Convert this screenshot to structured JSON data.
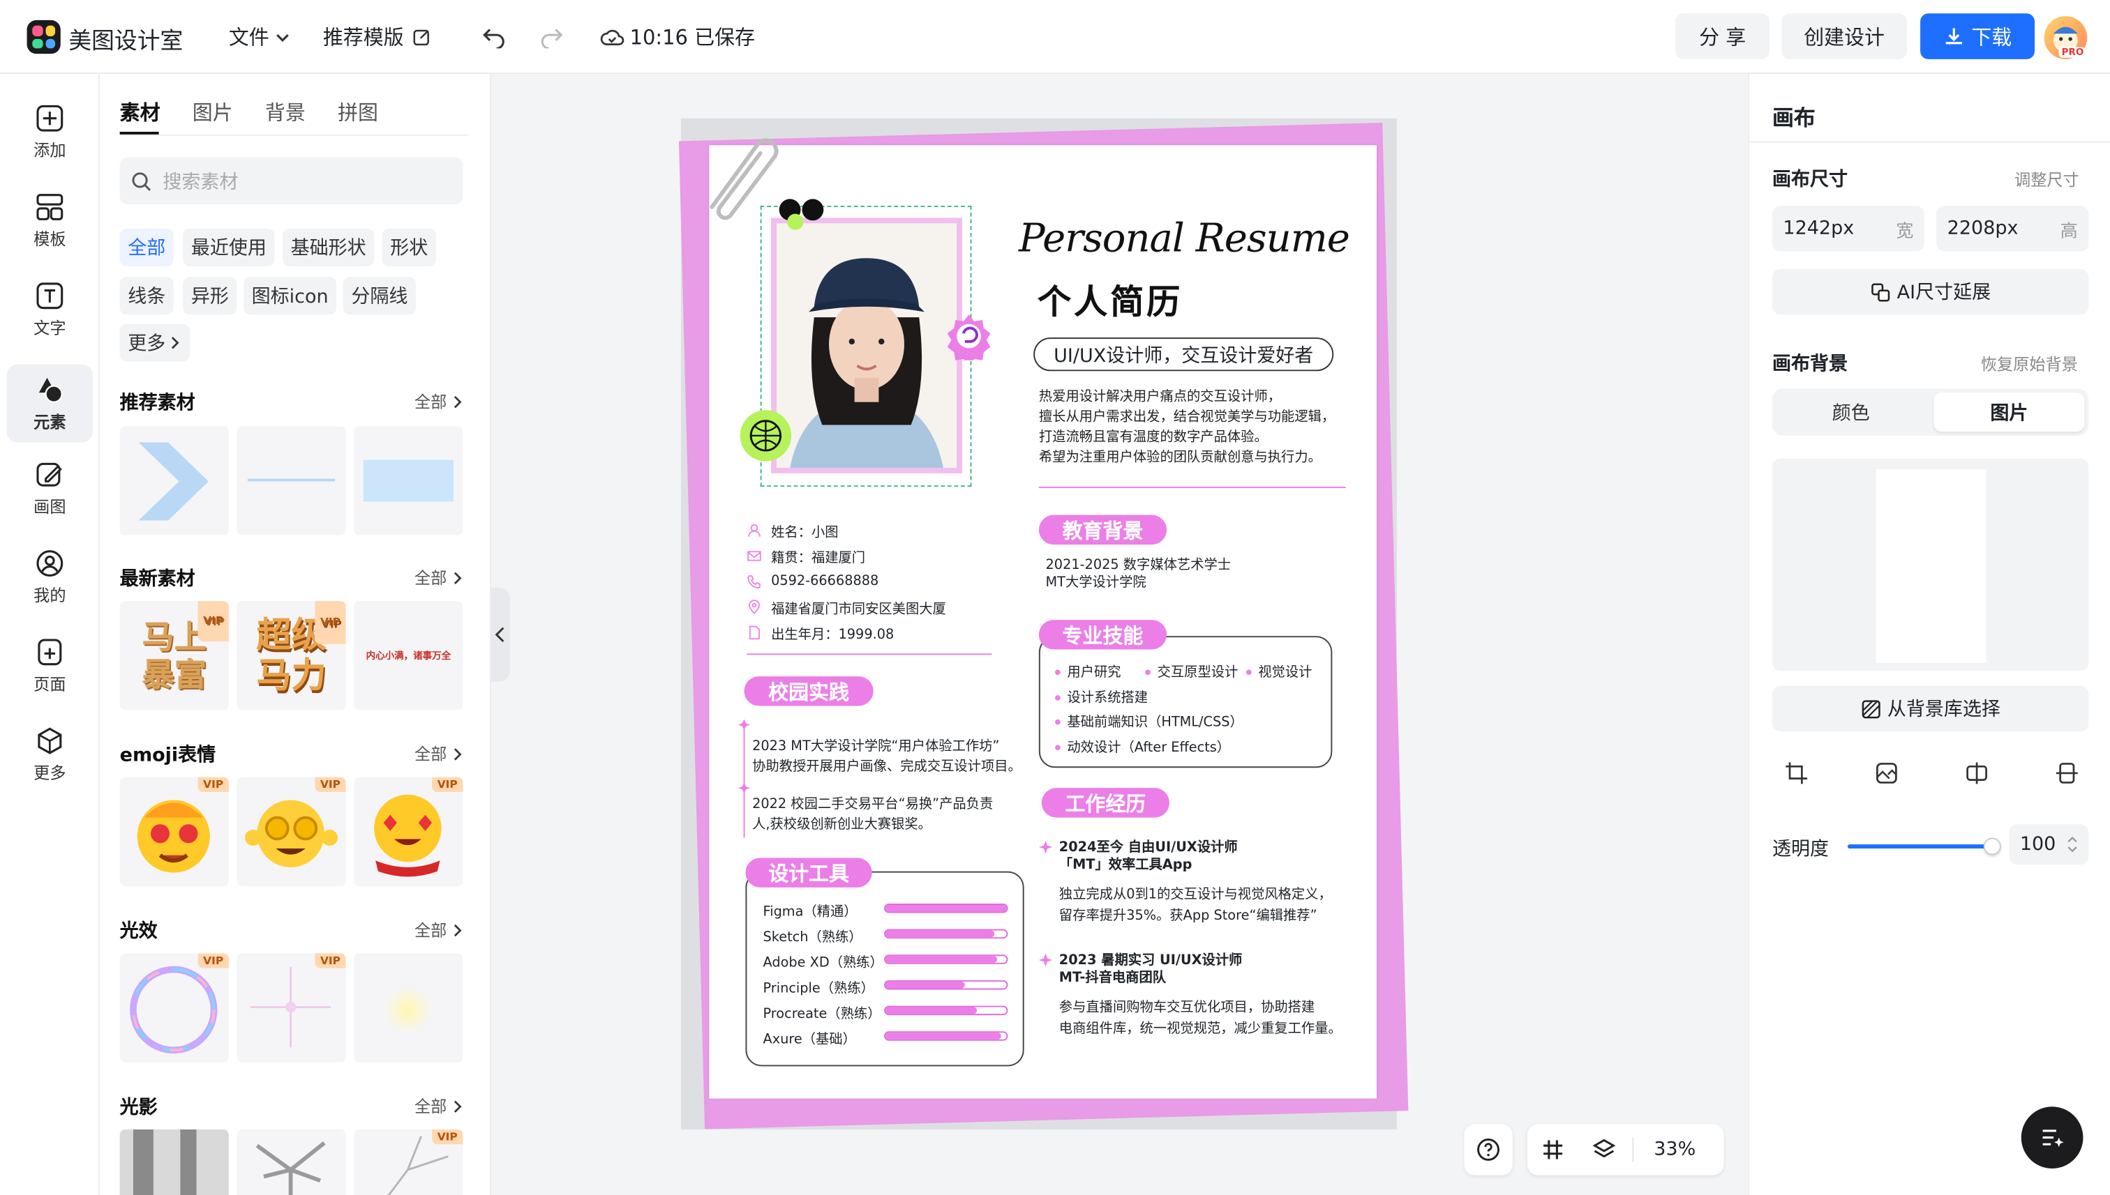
{
  "topbar": {
    "app_name": "美图设计室",
    "file_menu": "文件",
    "recommend_template": "推荐模版",
    "save_status": "10:16 已保存",
    "share": "分 享",
    "create_design": "创建设计",
    "download": "下载",
    "pro_badge": "PRO"
  },
  "rail": [
    {
      "label": "添加",
      "icon": "plus-square-icon"
    },
    {
      "label": "模板",
      "icon": "template-icon"
    },
    {
      "label": "文字",
      "icon": "text-icon"
    },
    {
      "label": "元素",
      "icon": "shapes-icon"
    },
    {
      "label": "画图",
      "icon": "draw-icon"
    },
    {
      "label": "我的",
      "icon": "user-icon"
    },
    {
      "label": "页面",
      "icon": "page-icon"
    },
    {
      "label": "更多",
      "icon": "cube-icon"
    }
  ],
  "panel": {
    "tabs": [
      "素材",
      "图片",
      "背景",
      "拼图"
    ],
    "search_placeholder": "搜索素材",
    "chips": [
      "全部",
      "最近使用",
      "基础形状",
      "形状",
      "线条",
      "异形",
      "图标icon",
      "分隔线",
      "更多"
    ],
    "all_label": "全部",
    "sections": [
      "推荐素材",
      "最新素材",
      "emoji表情",
      "光效",
      "光影"
    ],
    "vip": "VIP",
    "new_items": {
      "t1": "马上",
      "t2": "暴富",
      "t3": "超级",
      "t4": "马力",
      "t5": "内心小满，诸事万全"
    }
  },
  "resume": {
    "title_en": "Personal Resume",
    "title_cn": "个人简历",
    "role": "UI/UX设计师，交互设计爱好者",
    "intro": [
      "热爱用设计解决用户痛点的交互设计师，",
      "擅长从用户需求出发，结合视觉美学与功能逻辑，",
      "打造流畅且富有温度的数字产品体验。",
      "希望为注重用户体验的团队贡献创意与执行力。"
    ],
    "info": [
      "姓名：小图",
      "籍贯：福建厦门",
      "0592-66668888",
      "福建省厦门市同安区美图大厦",
      "出生年月：1999.08"
    ],
    "campus_title": "校园实践",
    "campus": [
      {
        "l1": "2023 MT大学设计学院“用户体验工作坊”",
        "l2": "协助教授开展用户画像、完成交互设计项目。"
      },
      {
        "l1": "2022 校园二手交易平台“易换”产品负责",
        "l2": "人,获校级创新创业大赛银奖。"
      }
    ],
    "tools_title": "设计工具",
    "tools": [
      {
        "name": "Figma（精通）",
        "level": 1.0
      },
      {
        "name": "Sketch（熟练）",
        "level": 0.9
      },
      {
        "name": "Adobe XD（熟练）",
        "level": 0.92
      },
      {
        "name": "Principle（熟练）",
        "level": 0.65
      },
      {
        "name": "Procreate（熟练）",
        "level": 0.75
      },
      {
        "name": "Axure（基础）",
        "level": 0.95
      }
    ],
    "edu_title": "教育背景",
    "edu": [
      "2021-2025  数字媒体艺术学士",
      "MT大学设计学院"
    ],
    "skills_title": "专业技能",
    "skills": [
      "用户研究",
      "交互原型设计",
      "视觉设计",
      "设计系统搭建",
      "基础前端知识（HTML/CSS）",
      "动效设计（After Effects）"
    ],
    "work_title": "工作经历",
    "work": [
      {
        "head1": "2024至今 自由UI/UX设计师",
        "head2": "「MT」效率工具App",
        "d1": "独立完成从0到1的交互设计与视觉风格定义，",
        "d2": "留存率提升35%。获App Store“编辑推荐”"
      },
      {
        "head1": "2023 暑期实习 UI/UX设计师",
        "head2": "MT-抖音电商团队",
        "d1": "参与直播间购物车交互优化项目，协助搭建",
        "d2": "电商组件库，统一视觉规范，减少重复工作量。"
      }
    ]
  },
  "canvas_tools": {
    "zoom": "33%"
  },
  "right": {
    "title": "画布",
    "size_title": "画布尺寸",
    "resize": "调整尺寸",
    "width_value": "1242px",
    "width_label": "宽",
    "height_value": "2208px",
    "height_label": "高",
    "ai_extend": "AI尺寸延展",
    "bg_title": "画布背景",
    "restore_bg": "恢复原始背景",
    "tab_color": "颜色",
    "tab_image": "图片",
    "from_library": "从背景库选择",
    "opacity_label": "透明度",
    "opacity_value": "100",
    "opacity_level": 1.0
  },
  "colors": {
    "accent": "#1e6fff",
    "pink": "#ec7ee8",
    "dark": "#1c1c1e"
  }
}
